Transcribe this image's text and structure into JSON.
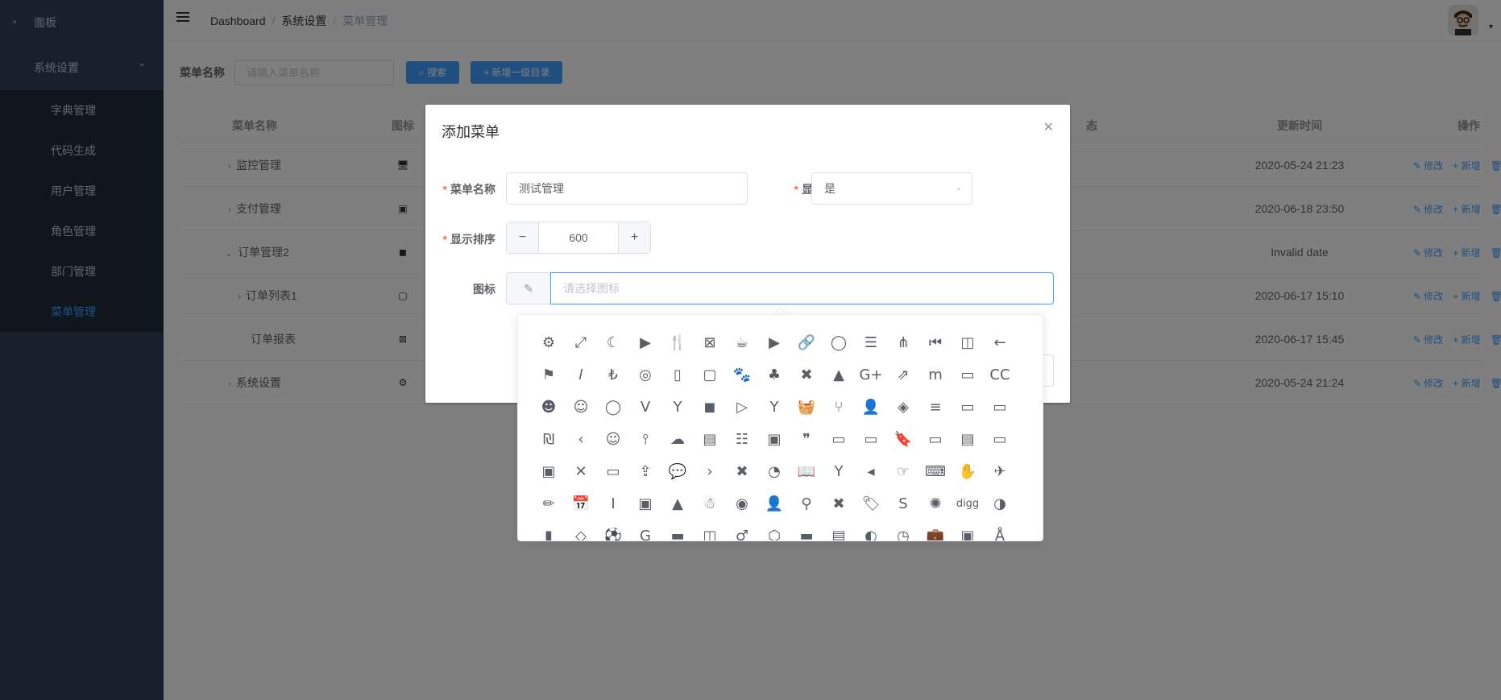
{
  "sidebar": {
    "dashboard_label": "面板",
    "group_label": "系统设置",
    "items": [
      "字典管理",
      "代码生成",
      "用户管理",
      "角色管理",
      "部门管理",
      "菜单管理"
    ],
    "active_index": 5
  },
  "header": {
    "breadcrumb": [
      "Dashboard",
      "系统设置",
      "菜单管理"
    ]
  },
  "search": {
    "label": "菜单名称",
    "placeholder": "请输入菜单名称",
    "search_button": "搜索",
    "add_button": "新增一级目录"
  },
  "table": {
    "columns": [
      "菜单名称",
      "图标",
      "更新时间",
      "操作"
    ],
    "status_fragment": "态",
    "rows": [
      {
        "name": "监控管理",
        "arrow": "›",
        "icon": "🖥",
        "time": "2020-05-24 21:23"
      },
      {
        "name": "支付管理",
        "arrow": "›",
        "icon": "▣",
        "time": "2020-06-18 23:50"
      },
      {
        "name": "订单管理2",
        "arrow": "⌄",
        "icon": "◼",
        "time": "Invalid date"
      },
      {
        "name": "订单列表1",
        "arrow": "›",
        "icon": "▢",
        "time": "2020-06-17 15:10"
      },
      {
        "name": "订单报表",
        "arrow": "",
        "icon": "⊠",
        "time": "2020-06-17 15:45"
      },
      {
        "name": "系统设置",
        "arrow": "›",
        "icon": "⚙",
        "time": "2020-05-24 21:24"
      }
    ],
    "ops": [
      "修改",
      "新增",
      "删除"
    ]
  },
  "dialog": {
    "title": "添加菜单",
    "name_label": "菜单名称",
    "name_value": "测试管理",
    "show_label": "显示",
    "show_value": "是",
    "order_label": "显示排序",
    "order_value": "600",
    "icon_label": "图标",
    "icon_placeholder": "请选择图标"
  },
  "icons": [
    "⚙",
    "⤢",
    "☾",
    "▶",
    "🍴",
    "⊠",
    "☕",
    "▶",
    "🔗",
    "◯",
    "☰",
    "⋔",
    "⏮",
    "◫",
    "←",
    "⚑",
    "𝐼",
    "₺",
    "◎",
    "▯",
    "▢",
    "🐾",
    "♣",
    "✖",
    "▲",
    "G+",
    "⇗",
    "m",
    "▭",
    "CC",
    "☻",
    "☺",
    "◯",
    "V",
    "Y",
    "◼",
    "▷",
    "Y",
    "🧺",
    "⑂",
    "👤",
    "◈",
    "≡",
    "▭",
    "▭",
    "₪",
    "‹",
    "☺",
    "⫯",
    "☁",
    "▤",
    "☷",
    "▣",
    "❞",
    "▭",
    "▭",
    "🔖",
    "▭",
    "▤",
    "▭",
    "▣",
    "✕",
    "▭",
    "⇪",
    "💬",
    "›",
    "✖",
    "◔",
    "📖",
    "Y",
    "◂",
    "☞",
    "⌨",
    "✋",
    "✈",
    "✏",
    "📅",
    "I",
    "▣",
    "▲",
    "☃",
    "◉",
    "👤",
    "⚲",
    "✖",
    "🏷",
    "S",
    "✺",
    "digg",
    "◑",
    "▮",
    "◇",
    "⚽",
    "G",
    "▬",
    "◫",
    "♂",
    "⬡",
    "▬",
    "▤",
    "◐",
    "◷",
    "💼",
    "▣",
    "Å"
  ]
}
